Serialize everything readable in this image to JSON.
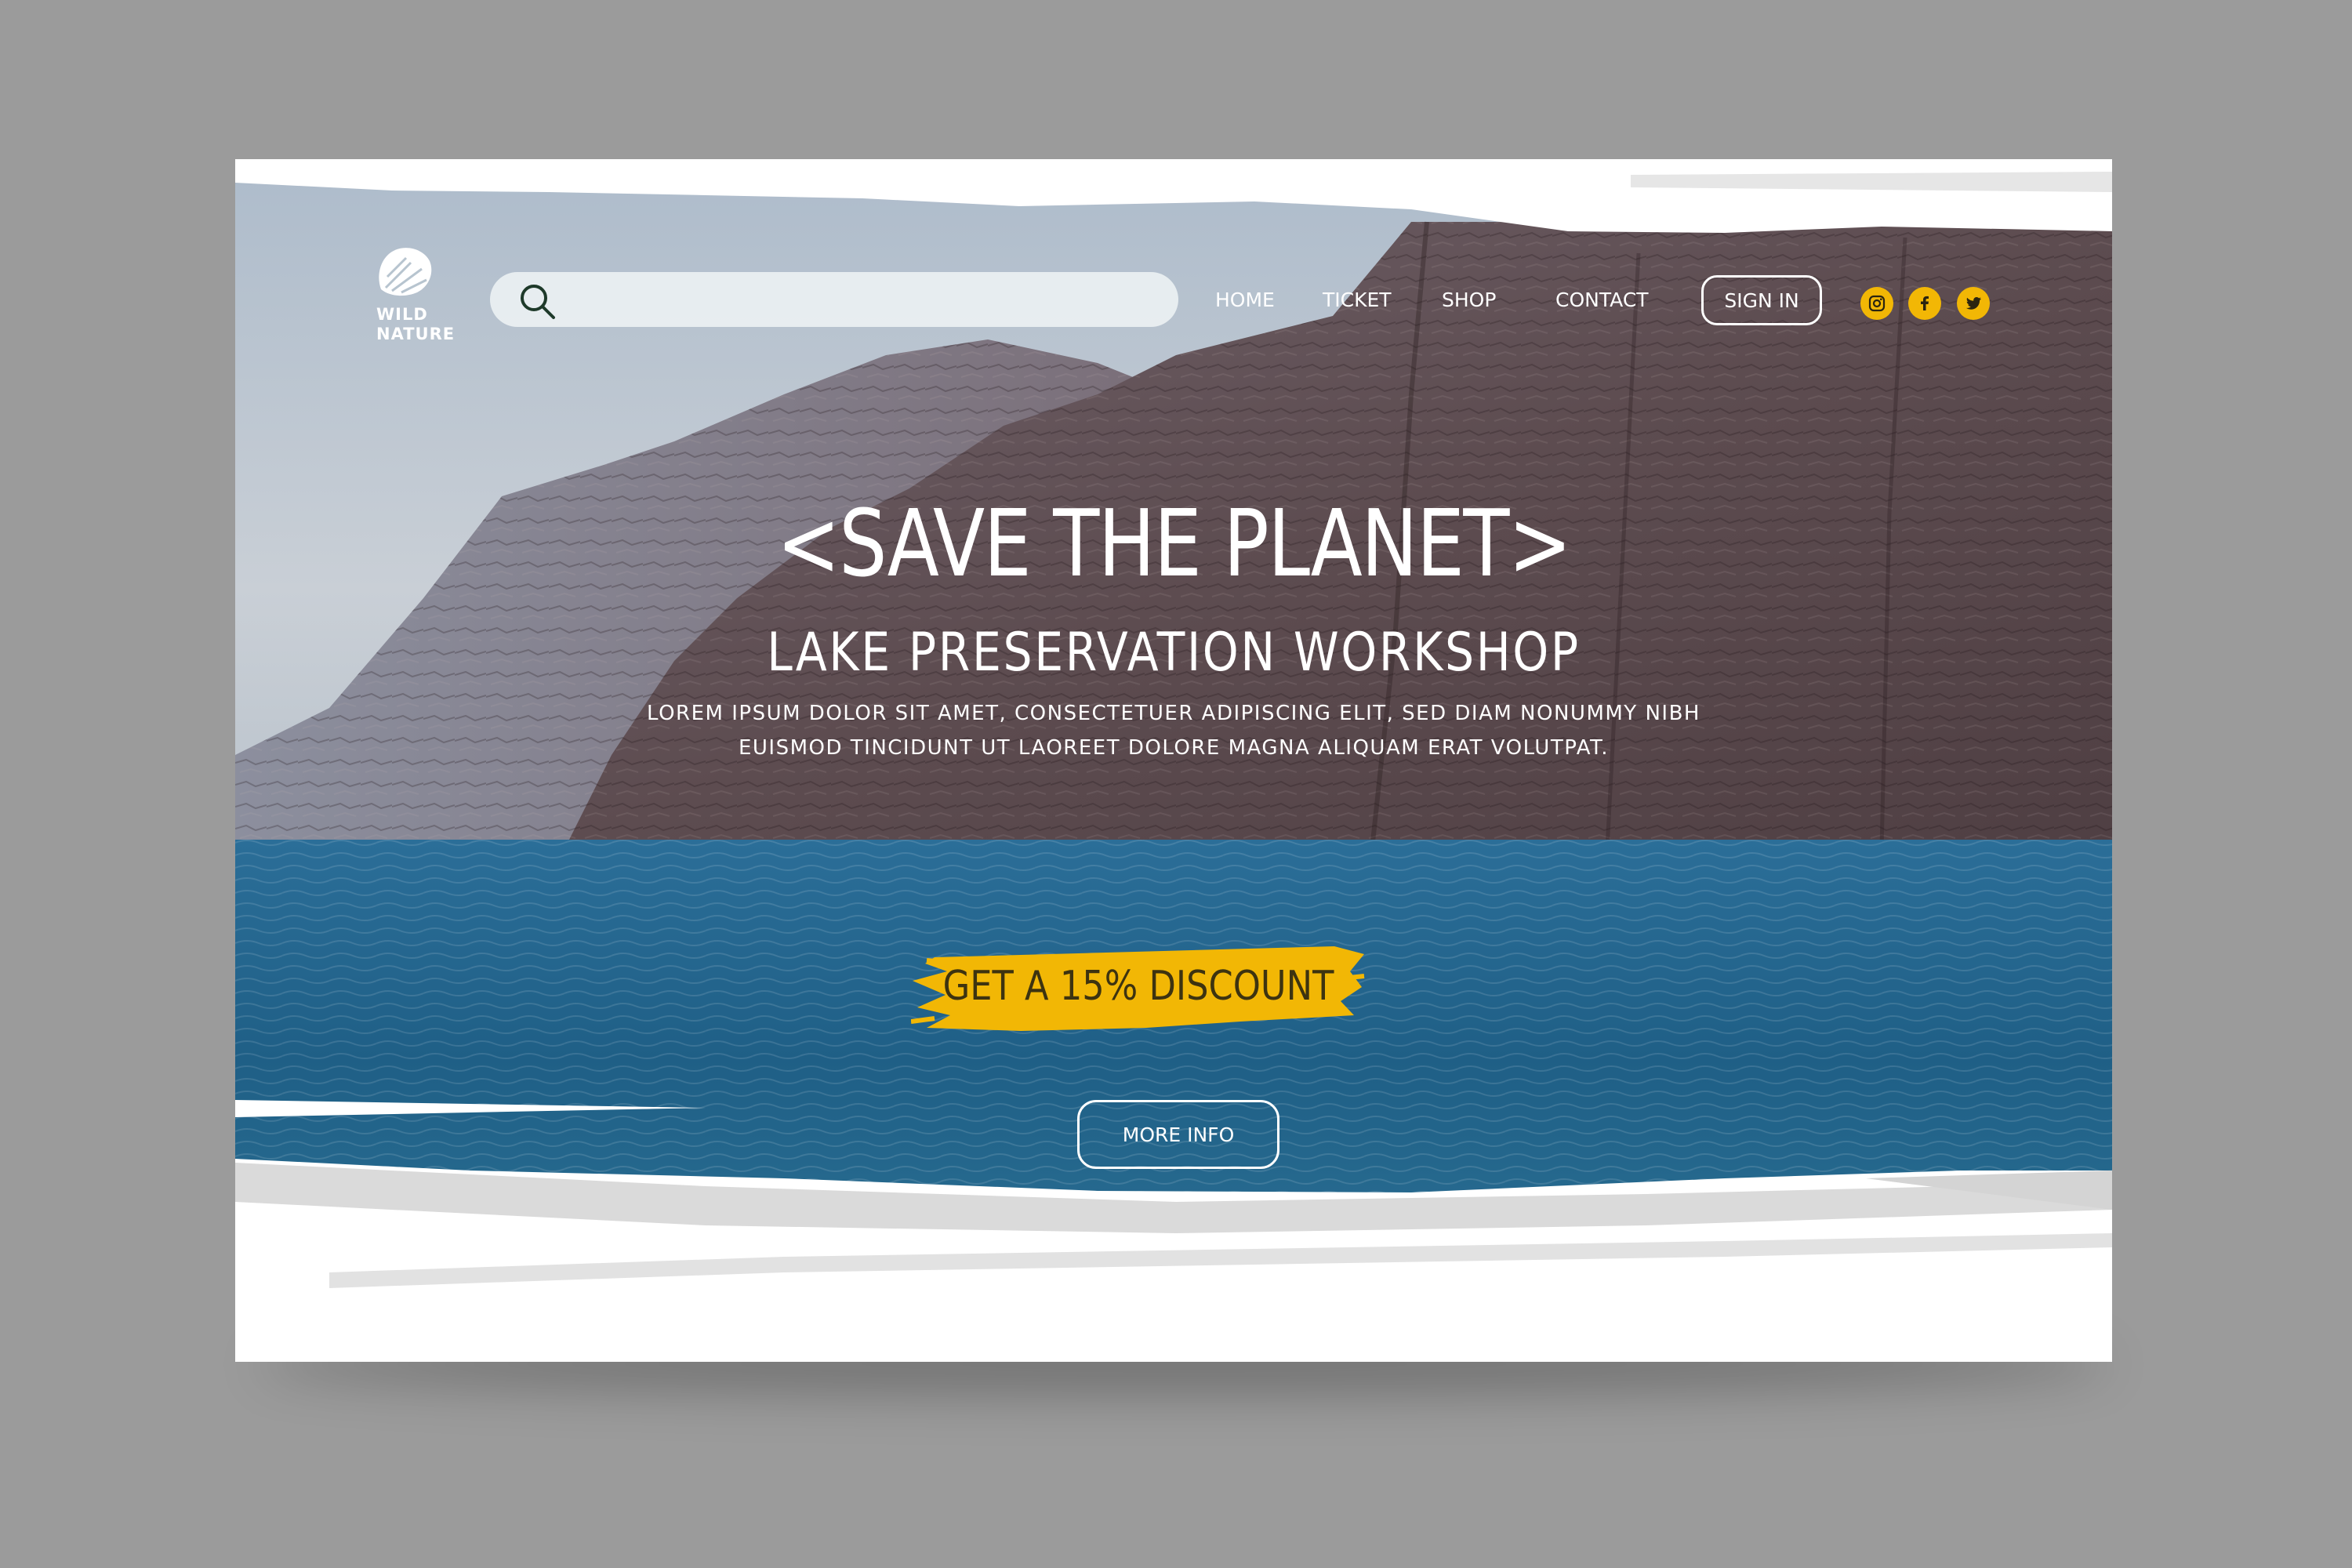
{
  "brand": {
    "logo_text": "WILD\nNATURE",
    "logo_icon": "monstera-leaf-icon"
  },
  "search": {
    "placeholder": "",
    "value": ""
  },
  "nav": {
    "items": [
      "HOME",
      "TICKET",
      "SHOP",
      "CONTACT"
    ],
    "sign_in_label": "SIGN IN"
  },
  "social": {
    "icons": [
      "instagram-icon",
      "facebook-icon",
      "twitter-icon"
    ],
    "accent_color": "#f2b705"
  },
  "hero": {
    "title": "<SAVE THE PLANET>",
    "subtitle": "LAKE PRESERVATION WORKSHOP",
    "body_line_1": "LOREM IPSUM DOLOR SIT AMET, CONSECTETUER ADIPISCING ELIT, SED DIAM NONUMMY NIBH",
    "body_line_2": "EUISMOD TINCIDUNT UT LAOREET DOLORE MAGNA ALIQUAM ERAT VOLUTPAT.",
    "discount_label": "GET A 15% DISCOUNT",
    "more_info_label": "MORE INFO"
  },
  "colors": {
    "page_background": "#9b9b9b",
    "water": "#1f5f86",
    "cliff": "#6b5a60",
    "highlight_brush": "#f2b705",
    "text": "#ffffff"
  }
}
